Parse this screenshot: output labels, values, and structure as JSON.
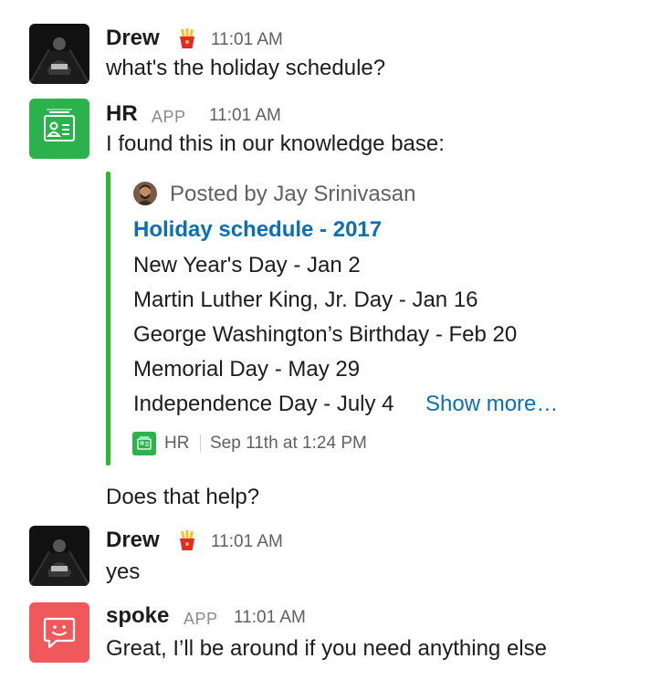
{
  "messages": [
    {
      "sender": "Drew",
      "emoji": "fries-icon",
      "time": "11:01 AM",
      "text": "what's the holiday schedule?"
    },
    {
      "sender": "HR",
      "badge": "APP",
      "time": "11:01 AM",
      "text": "I found this in our knowledge base:",
      "attachment": {
        "author": "Posted by Jay Srinivasan",
        "title": "Holiday schedule - 2017",
        "lines": [
          "New Year's Day - Jan 2",
          "Martin Luther King, Jr. Day - Jan 16",
          "George Washington’s Birthday - Feb 20",
          "Memorial Day - May 29",
          "Independence Day - July 4"
        ],
        "show_more": "Show more…",
        "footer_app": "HR",
        "footer_time": "Sep 11th at 1:24 PM",
        "accent_color": "#2eb82e"
      },
      "followup": "Does that help?"
    },
    {
      "sender": "Drew",
      "emoji": "fries-icon",
      "time": "11:01 AM",
      "text": "yes"
    },
    {
      "sender": "spoke",
      "badge": "APP",
      "time": "11:01 AM",
      "text": "Great, I’ll be around if you need anything else"
    }
  ],
  "colors": {
    "hr_green": "#2bb24c",
    "spoke_red": "#f0595b",
    "link_blue": "#0b6fb8"
  }
}
